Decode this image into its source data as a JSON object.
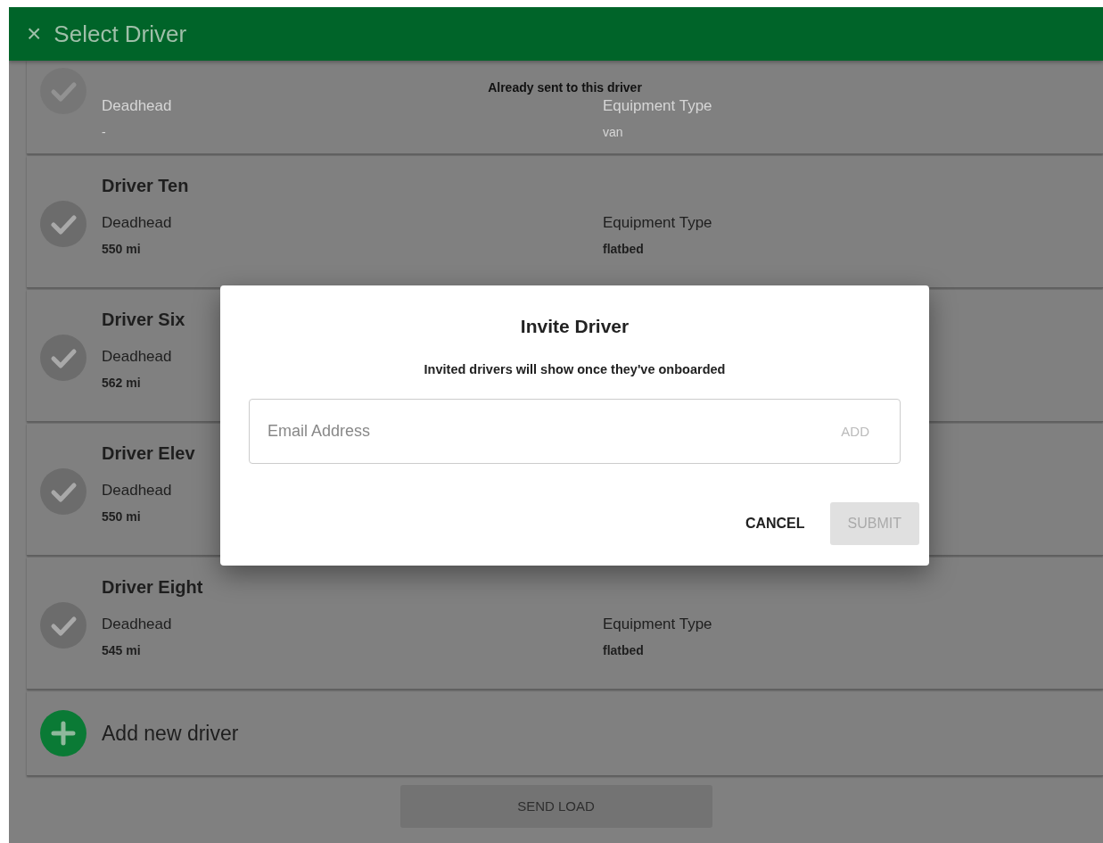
{
  "header": {
    "close_icon": "×",
    "title": "Select Driver"
  },
  "drivers": [
    {
      "deadhead_label": "Deadhead",
      "deadhead": "-",
      "equipment_label": "Equipment Type",
      "equipment": "van",
      "selected": false,
      "sent": true,
      "notice": "Already sent to this driver"
    },
    {
      "name": "Driver Ten",
      "deadhead_label": "Deadhead",
      "deadhead": "550 mi",
      "equipment_label": "Equipment Type",
      "equipment": "flatbed",
      "selected": false,
      "sent": false
    },
    {
      "name": "Driver Six",
      "deadhead_label": "Deadhead",
      "deadhead": "562 mi",
      "selected": false,
      "sent": false
    },
    {
      "name": "Driver Elev",
      "deadhead_label": "Deadhead",
      "deadhead": "550 mi",
      "selected": false,
      "sent": false
    },
    {
      "name": "Driver Eight",
      "deadhead_label": "Deadhead",
      "deadhead": "545 mi",
      "equipment_label": "Equipment Type",
      "equipment": "flatbed",
      "selected": false,
      "sent": false
    }
  ],
  "add_driver": {
    "label": "Add new driver"
  },
  "send_button": {
    "label": "SEND LOAD",
    "disabled": true
  },
  "dialog": {
    "title": "Invite Driver",
    "message": "Invited drivers will show once they've onboarded",
    "email_field": {
      "placeholder": "Email Address"
    },
    "add_button": {
      "label": "ADD",
      "disabled": true
    },
    "buttons": [
      {
        "label": "CANCEL",
        "disabled": false
      },
      {
        "label": "SUBMIT",
        "disabled": true
      }
    ]
  }
}
